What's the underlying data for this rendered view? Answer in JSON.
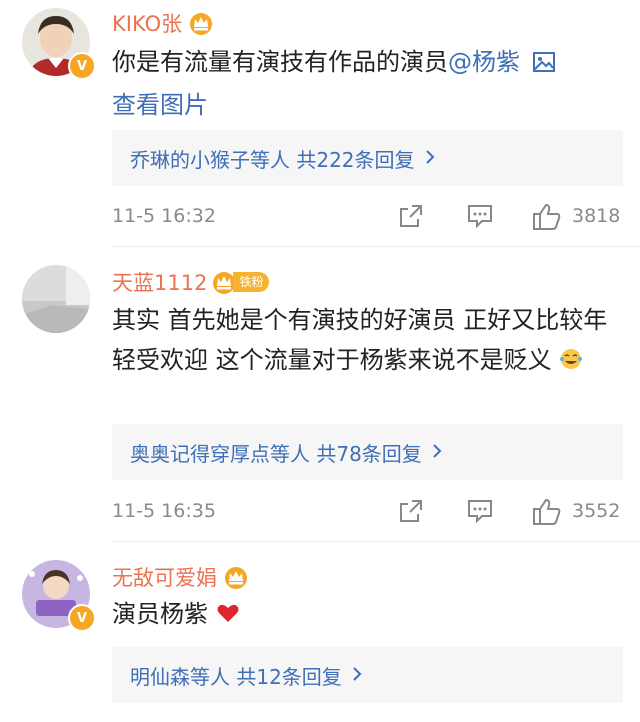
{
  "comments": [
    {
      "name": "KIKO张",
      "text_before": "你是有流量有演技有作品的演员",
      "mention": "@杨紫",
      "image_link": "查看图片",
      "reply_summary": "乔琳的小猴子等人 共222条回复",
      "time": "11-5 16:32",
      "likes": "3818",
      "avatar_color": "#d8d8d8"
    },
    {
      "name": "天蓝1112",
      "fan_badge": "铁粉",
      "text": "其实 首先她是个有演技的好演员 正好又比较年轻受欢迎 这个流量对于杨紫来说不是贬义",
      "reply_summary": "奥奥记得穿厚点等人 共78条回复",
      "time": "11-5 16:35",
      "likes": "3552"
    },
    {
      "name": "无敌可爱娟",
      "text": "演员杨紫",
      "reply_summary": "明仙森等人 共12条回复"
    }
  ],
  "icons": {
    "verified": "v-badge-icon",
    "crown": "crown-icon",
    "image": "image-icon",
    "share": "share-icon",
    "comment": "comment-icon",
    "like": "thumbs-up-icon",
    "chevron": "chevron-right-icon",
    "laugh": "laugh-cry-emoji-icon",
    "heart": "heart-emoji-icon"
  },
  "colors": {
    "name": "#eb7350",
    "link": "#3f6fb6",
    "meta": "#8a8a8a",
    "reply_bg": "#f6f6f6"
  }
}
